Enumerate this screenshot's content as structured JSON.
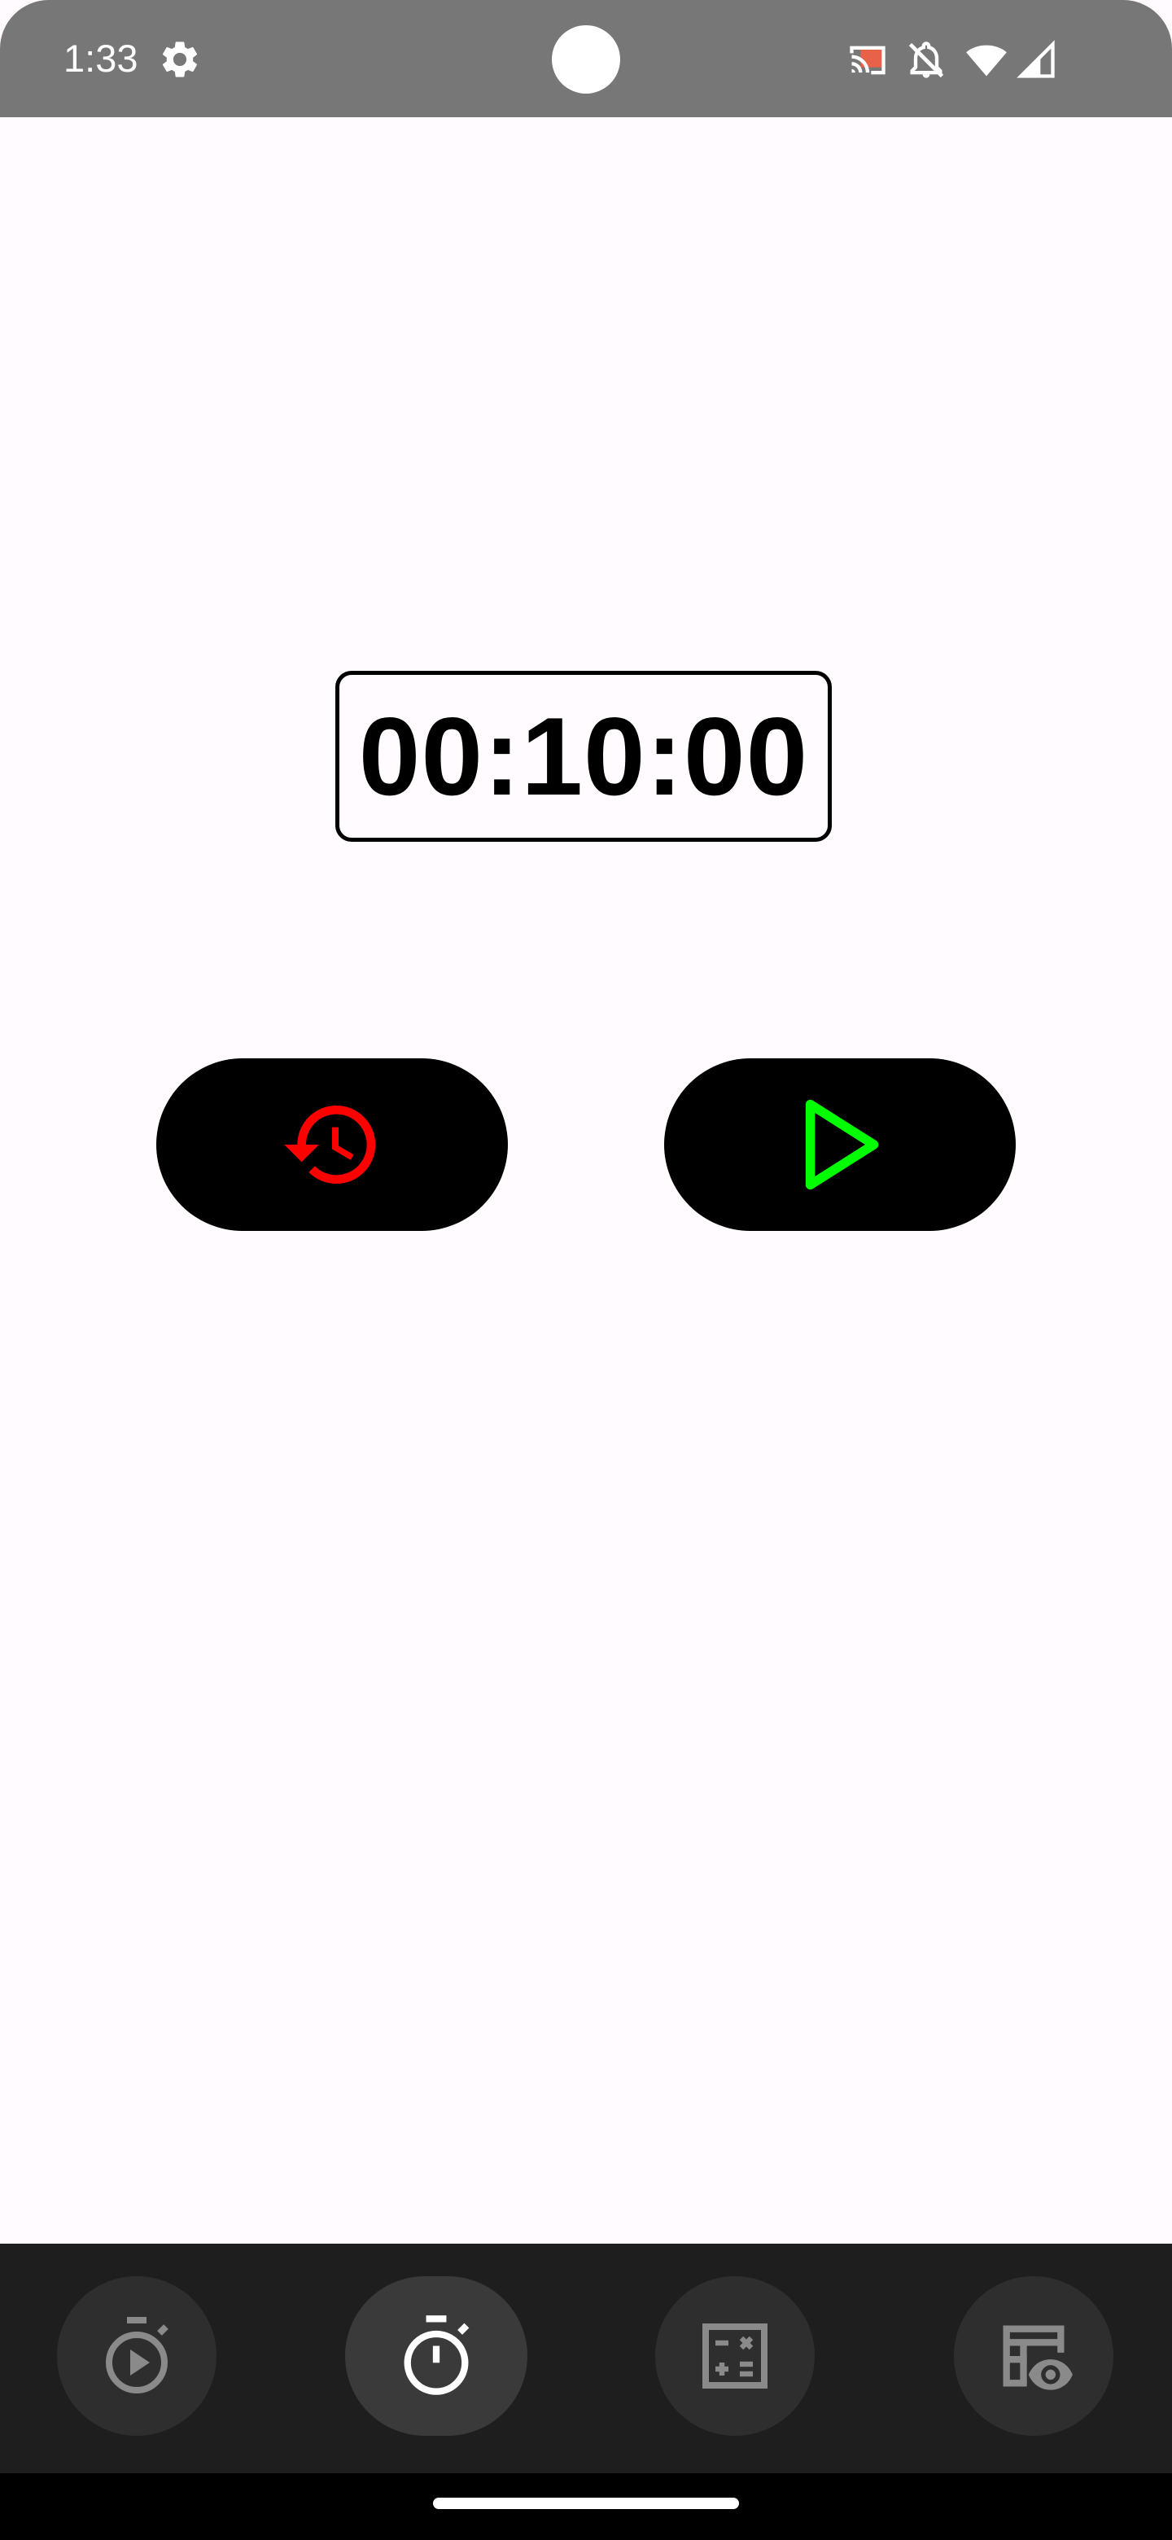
{
  "status_bar": {
    "time": "1:33",
    "icons": [
      "settings-gear-icon",
      "cast-icon",
      "notifications-off-icon",
      "wifi-icon",
      "cellular-signal-icon"
    ],
    "background": "#777777"
  },
  "timer": {
    "display": "00:10:00"
  },
  "controls": {
    "reset_icon": "history-icon",
    "reset_color": "#ff0000",
    "start_icon": "play-icon",
    "start_color": "#00ff00",
    "button_background": "#000000"
  },
  "bottom_nav": {
    "items": [
      {
        "icon": "timer-play-icon",
        "active": false
      },
      {
        "icon": "stopwatch-icon",
        "active": true
      },
      {
        "icon": "calculator-icon",
        "active": false
      },
      {
        "icon": "table-view-icon",
        "active": false
      }
    ]
  }
}
